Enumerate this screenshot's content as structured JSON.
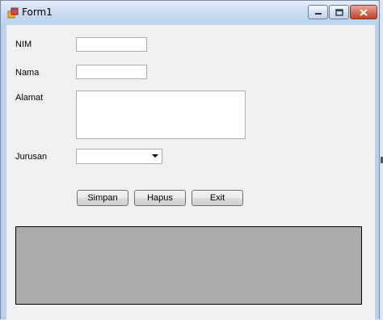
{
  "window": {
    "title": "Form1",
    "icon": "winforms-app-icon",
    "caption_buttons": [
      "minimize-icon",
      "maximize-icon",
      "close-icon"
    ]
  },
  "form": {
    "nim_label": "NIM",
    "nim_value": "",
    "nama_label": "Nama",
    "nama_value": "",
    "alamat_label": "Alamat",
    "alamat_value": "",
    "jurusan_label": "Jurusan",
    "jurusan_selected": ""
  },
  "buttons": {
    "simpan": "Simpan",
    "hapus": "Hapus",
    "exit": "Exit"
  },
  "grid": {
    "rows": []
  },
  "colors": {
    "grid_background": "#ababab",
    "form_background": "#f0f0f0",
    "titlebar": "#c6daf0"
  }
}
